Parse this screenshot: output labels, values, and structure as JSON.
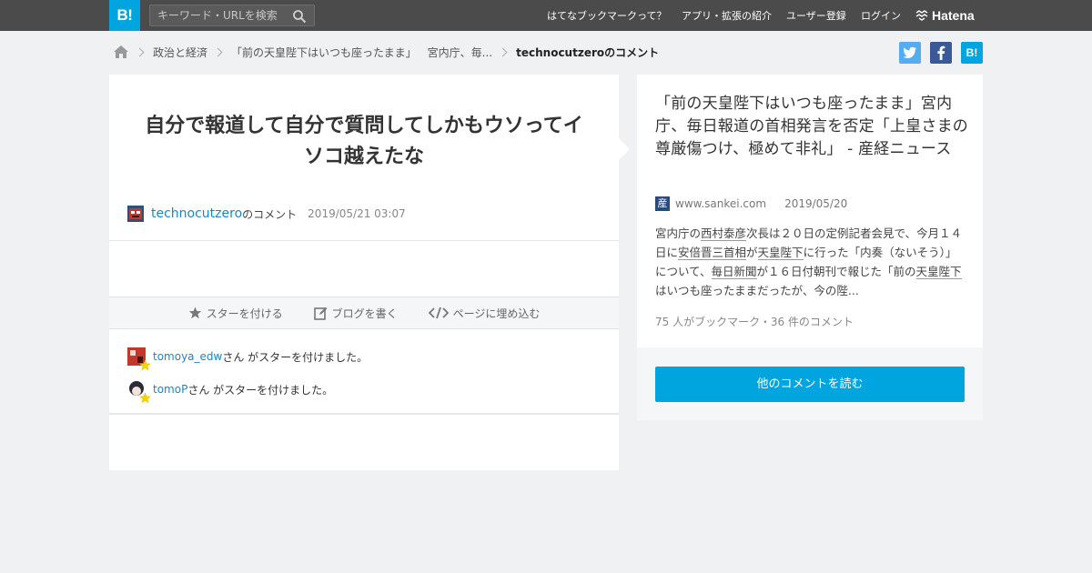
{
  "header": {
    "logo_text": "B!",
    "search": {
      "placeholder": "キーワード・URLを検索",
      "value": ""
    },
    "nav": [
      "はてなブックマークって？",
      "アプリ・拡張の紹介",
      "ユーザー登録",
      "ログイン"
    ],
    "brand": "Hatena",
    "bar_color": "#4b4b4b",
    "accent_color": "#00a4de"
  },
  "breadcrumb": {
    "category": "政治と経済",
    "entry_short_1": "「前の天皇陛下はいつも座ったまま」",
    "entry_short_2": "宮内庁、毎...",
    "current": "technocutzeroのコメント"
  },
  "social": {
    "hatena_label": "B!"
  },
  "comment": {
    "text": "自分で報道して自分で質問してしかもウソってイソコ越えたな",
    "user": "technocutzero",
    "suffix": "のコメント",
    "timestamp": "2019/05/21 03:07"
  },
  "actions": [
    {
      "label": "スターを付ける",
      "icon": "star-icon"
    },
    {
      "label": "ブログを書く",
      "icon": "edit-icon"
    },
    {
      "label": "ページに埋め込む",
      "icon": "code-icon"
    }
  ],
  "stars": [
    {
      "user": "tomoya_edw",
      "text": "さん がスターを付けました。"
    },
    {
      "user": "tomoP",
      "text": "さん がスターを付けました。"
    }
  ],
  "entry": {
    "title": "「前の天皇陛下はいつも座ったまま」宮内庁、毎日報道の首相発言を否定「上皇さまの尊厳傷つけ、極めて非礼」 - 産経ニュース",
    "domain": "www.sankei.com",
    "date": "2019/05/20",
    "summary_parts": [
      "宮内庁の",
      "西村泰彦",
      "次長は２０日の定例記者会見で、今月１４日に",
      "安倍晋三首相",
      "が",
      "天皇陛下",
      "に行った「内奏（ないそう）」について、",
      "毎日新聞",
      "が１６日付朝刊で報じた「前の",
      "天皇陛下",
      "はいつも座ったままだったが、今の陛..."
    ],
    "counts": "75 人がブックマーク・36 件のコメント",
    "more_button": "他のコメントを読む"
  }
}
